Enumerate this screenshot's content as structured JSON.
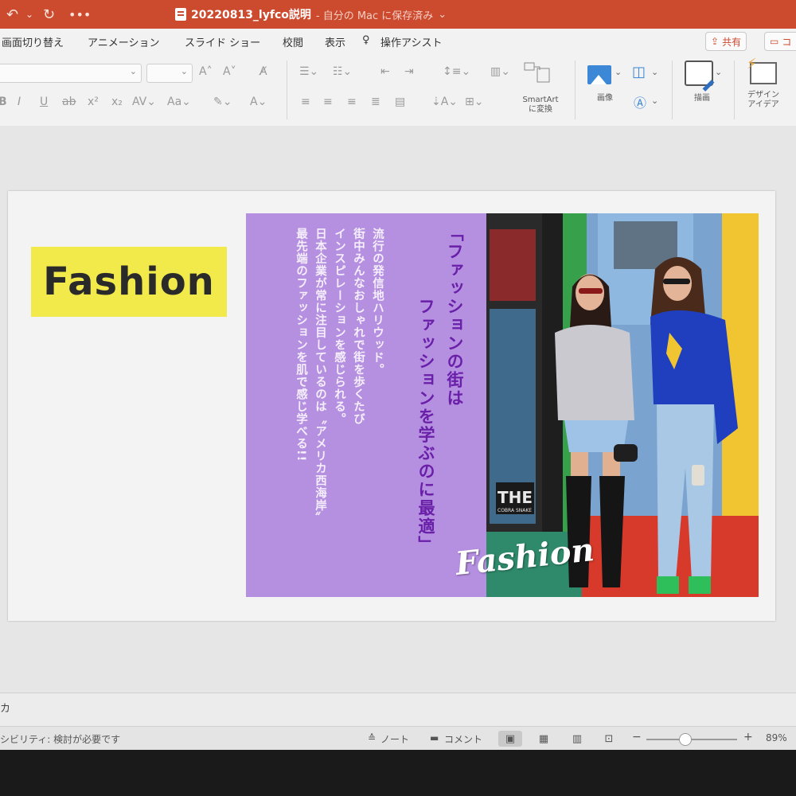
{
  "titlebar": {
    "filename": "20220813_lyfco説明",
    "save_status": "- 自分の Mac に保存済み",
    "icons": [
      "undo-icon",
      "redo-icon",
      "more-icon"
    ]
  },
  "tabs": {
    "items": [
      "画面切り替え",
      "アニメーション",
      "スライド ショー",
      "校閲",
      "表示"
    ],
    "assist": "操作アシスト",
    "share": "共有",
    "comment": "コ"
  },
  "ribbon": {
    "smartart_line1": "SmartArt",
    "smartart_line2": "に変換",
    "image": "画像",
    "draw": "描画",
    "design_line1": "デザイン",
    "design_line2": "アイデア"
  },
  "slide": {
    "title": "Fashion",
    "headline_lines": [
      "「ファッションの街は",
      "ファッションを学ぶのに最適」"
    ],
    "body_lines": [
      "流行の発信地ハリウッド。",
      "街中みんなおしゃれで街を歩くたび",
      "インスピレーションを感じられる。",
      "日本企業が常に注目しているのは〝アメリカ西海岸〟",
      "最先端のファッションを肌で感じ学べる!!"
    ],
    "photo_sign": "THE",
    "photo_sign_sub": "COBRA SNAKE",
    "photo_caption": "Fashion"
  },
  "notes": {
    "text": "カ"
  },
  "status": {
    "accessibility": "シビリティ: 検討が必要です",
    "notes_btn": "ノート",
    "comments_btn": "コメント",
    "zoom_minus": "−",
    "zoom_plus": "+",
    "zoom": "89%"
  },
  "colors": {
    "titlebar": "#cc4a2e",
    "fashion_highlight": "#f2ea4a",
    "purple_panel": "#b58fe0",
    "headline": "#6a1fa8"
  }
}
